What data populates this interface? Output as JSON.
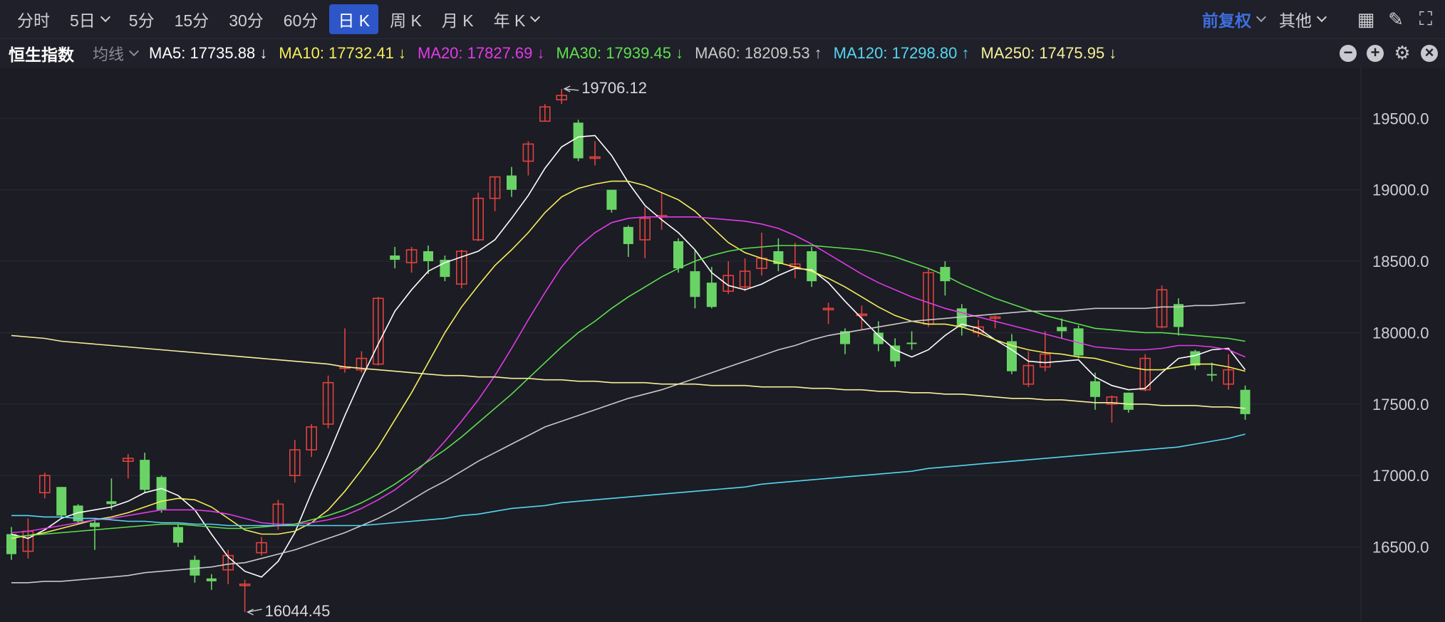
{
  "toolbar": {
    "tabs": [
      {
        "label": "分时",
        "dropdown": false,
        "active": false
      },
      {
        "label": "5日",
        "dropdown": true,
        "active": false
      },
      {
        "label": "5分",
        "dropdown": false,
        "active": false
      },
      {
        "label": "15分",
        "dropdown": false,
        "active": false
      },
      {
        "label": "30分",
        "dropdown": false,
        "active": false
      },
      {
        "label": "60分",
        "dropdown": false,
        "active": false
      },
      {
        "label": "日 K",
        "dropdown": false,
        "active": true
      },
      {
        "label": "周 K",
        "dropdown": false,
        "active": false
      },
      {
        "label": "月 K",
        "dropdown": false,
        "active": false
      },
      {
        "label": "年 K",
        "dropdown": true,
        "active": false
      }
    ],
    "adjust_label": "前复权",
    "other_label": "其他",
    "icons": [
      "grid-icon",
      "brush-icon",
      "fullscreen-icon"
    ]
  },
  "ma_bar": {
    "index_name": "恒生指数",
    "ma_selector": "均线",
    "items": [
      {
        "text": "MA5: 17735.88 ↓",
        "color": "#ffffff"
      },
      {
        "text": "MA10: 17732.41 ↓",
        "color": "#f5ef5a"
      },
      {
        "text": "MA20: 17827.69 ↓",
        "color": "#e23ae8"
      },
      {
        "text": "MA30: 17939.45 ↓",
        "color": "#5ee04e"
      },
      {
        "text": "MA60: 18209.53 ↑",
        "color": "#c9c9c9"
      },
      {
        "text": "MA120: 17298.80 ↑",
        "color": "#56d6f2"
      },
      {
        "text": "MA250: 17475.95 ↓",
        "color": "#f7f09a"
      }
    ]
  },
  "colors": {
    "up": "#e0423d",
    "down": "#6ad366",
    "grid": "#2a2b34",
    "axis_text": "#cfcfd4"
  },
  "chart_data": {
    "type": "candlestick",
    "y_ticks": [
      {
        "value": 16500,
        "label": "16500.0"
      },
      {
        "value": 17000,
        "label": "17000.0"
      },
      {
        "value": 17500,
        "label": "17500.0"
      },
      {
        "value": 18000,
        "label": "18000.0"
      },
      {
        "value": 18500,
        "label": "18500.0"
      },
      {
        "value": 19000,
        "label": "19000.0"
      },
      {
        "value": 19500,
        "label": "19500.0"
      }
    ],
    "ylim": [
      15975,
      19855
    ],
    "high_annotation": {
      "label": "19706.12",
      "value": 19706.12,
      "candle": 33
    },
    "low_annotation": {
      "label": "16044.45",
      "value": 16044.45,
      "candle": 14
    },
    "candles": [
      [
        16590,
        16450,
        16640,
        16410
      ],
      [
        16470,
        16610,
        16700,
        16420
      ],
      [
        16880,
        17000,
        17020,
        16840
      ],
      [
        16920,
        16720,
        16920,
        16700
      ],
      [
        16790,
        16680,
        16800,
        16660
      ],
      [
        16670,
        16640,
        16700,
        16480
      ],
      [
        16820,
        16800,
        16980,
        16760
      ],
      [
        17100,
        17120,
        17150,
        16980
      ],
      [
        17110,
        16900,
        17160,
        16880
      ],
      [
        16990,
        16760,
        17000,
        16740
      ],
      [
        16640,
        16530,
        16660,
        16500
      ],
      [
        16410,
        16300,
        16440,
        16250
      ],
      [
        16280,
        16260,
        16310,
        16200
      ],
      [
        16340,
        16440,
        16480,
        16240
      ],
      [
        16240,
        16240,
        16270,
        16044.45
      ],
      [
        16460,
        16530,
        16570,
        16440
      ],
      [
        16650,
        16800,
        16830,
        16620
      ],
      [
        17000,
        17180,
        17250,
        16950
      ],
      [
        17180,
        17340,
        17360,
        17130
      ],
      [
        17360,
        17650,
        17700,
        17330
      ],
      [
        17750,
        17760,
        18030,
        17720
      ],
      [
        17740,
        17820,
        17870,
        17720
      ],
      [
        17780,
        18240,
        18250,
        17770
      ],
      [
        18540,
        18510,
        18600,
        18450
      ],
      [
        18490,
        18580,
        18600,
        18420
      ],
      [
        18570,
        18500,
        18610,
        18410
      ],
      [
        18510,
        18390,
        18540,
        18360
      ],
      [
        18340,
        18570,
        18580,
        18310
      ],
      [
        18650,
        18940,
        18980,
        18640
      ],
      [
        18940,
        19090,
        19090,
        18850
      ],
      [
        19100,
        19000,
        19160,
        18950
      ],
      [
        19200,
        19320,
        19340,
        19100
      ],
      [
        19480,
        19580,
        19600,
        19480
      ],
      [
        19630,
        19660,
        19706.12,
        19600
      ],
      [
        19470,
        19220,
        19490,
        19200
      ],
      [
        19220,
        19230,
        19340,
        19170
      ],
      [
        19000,
        18860,
        19000,
        18840
      ],
      [
        18740,
        18620,
        18750,
        18530
      ],
      [
        18650,
        18800,
        18880,
        18520
      ],
      [
        18820,
        18820,
        18980,
        18720
      ],
      [
        18640,
        18450,
        18660,
        18420
      ],
      [
        18430,
        18250,
        18580,
        18170
      ],
      [
        18350,
        18180,
        18460,
        18170
      ],
      [
        18290,
        18400,
        18500,
        18270
      ],
      [
        18320,
        18430,
        18520,
        18290
      ],
      [
        18450,
        18520,
        18700,
        18400
      ],
      [
        18570,
        18480,
        18660,
        18430
      ],
      [
        18460,
        18480,
        18630,
        18380
      ],
      [
        18570,
        18360,
        18600,
        18320
      ],
      [
        18170,
        18170,
        18210,
        18060
      ],
      [
        18010,
        17920,
        18030,
        17850
      ],
      [
        18120,
        18130,
        18190,
        18020
      ],
      [
        18000,
        17920,
        18080,
        17870
      ],
      [
        17910,
        17800,
        17960,
        17760
      ],
      [
        17930,
        17920,
        18010,
        17880
      ],
      [
        18060,
        18420,
        18450,
        18040
      ],
      [
        18460,
        18360,
        18500,
        18260
      ],
      [
        18170,
        18040,
        18200,
        17980
      ],
      [
        18000,
        18040,
        18090,
        17970
      ],
      [
        18100,
        18110,
        18120,
        18030
      ],
      [
        17940,
        17730,
        17990,
        17710
      ],
      [
        17640,
        17770,
        17870,
        17620
      ],
      [
        17760,
        17850,
        18010,
        17730
      ],
      [
        18040,
        18010,
        18100,
        17960
      ],
      [
        18030,
        17840,
        18050,
        17820
      ],
      [
        17660,
        17550,
        17720,
        17460
      ],
      [
        17500,
        17550,
        17560,
        17370
      ],
      [
        17580,
        17460,
        17580,
        17440
      ],
      [
        17600,
        17820,
        17850,
        17590
      ],
      [
        18040,
        18300,
        18330,
        18030
      ],
      [
        18200,
        18040,
        18240,
        17980
      ],
      [
        17870,
        17770,
        17880,
        17740
      ],
      [
        17710,
        17700,
        17790,
        17660
      ],
      [
        17640,
        17740,
        17850,
        17600
      ],
      [
        17600,
        17430,
        17630,
        17390
      ]
    ],
    "series": [
      {
        "name": "MA5",
        "color": "#ffffff",
        "values": [
          16590,
          16560,
          16620,
          16700,
          16740,
          16760,
          16780,
          16820,
          16880,
          16910,
          16860,
          16760,
          16590,
          16430,
          16330,
          16290,
          16400,
          16600,
          16880,
          17140,
          17420,
          17680,
          17920,
          18150,
          18300,
          18430,
          18490,
          18530,
          18570,
          18650,
          18800,
          18960,
          19150,
          19300,
          19370,
          19380,
          19240,
          19050,
          18890,
          18790,
          18700,
          18580,
          18420,
          18330,
          18300,
          18340,
          18400,
          18450,
          18440,
          18350,
          18220,
          18100,
          17980,
          17880,
          17830,
          17880,
          17980,
          18060,
          18030,
          17950,
          17880,
          17800,
          17790,
          17800,
          17810,
          17690,
          17630,
          17600,
          17610,
          17720,
          17820,
          17840,
          17880,
          17890,
          17740
        ]
      },
      {
        "name": "MA10",
        "color": "#f5ef5a",
        "values": [
          16560,
          16580,
          16600,
          16630,
          16660,
          16690,
          16710,
          16740,
          16780,
          16820,
          16840,
          16830,
          16780,
          16700,
          16620,
          16590,
          16590,
          16610,
          16670,
          16760,
          16890,
          17040,
          17200,
          17390,
          17580,
          17790,
          18000,
          18180,
          18330,
          18470,
          18580,
          18700,
          18840,
          18950,
          19010,
          19040,
          19060,
          19060,
          19030,
          18980,
          18930,
          18850,
          18740,
          18630,
          18560,
          18520,
          18490,
          18460,
          18430,
          18380,
          18320,
          18250,
          18180,
          18120,
          18080,
          18060,
          18060,
          18040,
          18000,
          17950,
          17910,
          17880,
          17860,
          17850,
          17830,
          17820,
          17790,
          17760,
          17740,
          17740,
          17760,
          17780,
          17780,
          17760,
          17730
        ]
      },
      {
        "name": "MA20",
        "color": "#e23ae8",
        "values": [
          16600,
          16610,
          16630,
          16650,
          16670,
          16690,
          16700,
          16720,
          16740,
          16760,
          16760,
          16760,
          16750,
          16730,
          16700,
          16670,
          16660,
          16660,
          16670,
          16690,
          16720,
          16770,
          16830,
          16900,
          16990,
          17110,
          17240,
          17380,
          17530,
          17700,
          17890,
          18090,
          18280,
          18460,
          18600,
          18700,
          18770,
          18800,
          18810,
          18810,
          18810,
          18810,
          18800,
          18790,
          18780,
          18760,
          18730,
          18680,
          18620,
          18550,
          18480,
          18410,
          18350,
          18300,
          18250,
          18210,
          18170,
          18140,
          18110,
          18080,
          18050,
          18020,
          17990,
          17960,
          17930,
          17900,
          17890,
          17880,
          17880,
          17890,
          17910,
          17910,
          17900,
          17880,
          17830
        ]
      },
      {
        "name": "MA30",
        "color": "#5ee04e",
        "values": [
          16570,
          16580,
          16590,
          16600,
          16610,
          16620,
          16630,
          16640,
          16650,
          16660,
          16660,
          16650,
          16640,
          16630,
          16630,
          16640,
          16650,
          16660,
          16690,
          16720,
          16760,
          16810,
          16870,
          16940,
          17020,
          17100,
          17180,
          17270,
          17370,
          17470,
          17570,
          17680,
          17790,
          17900,
          18000,
          18080,
          18170,
          18250,
          18320,
          18390,
          18450,
          18500,
          18540,
          18570,
          18590,
          18600,
          18610,
          18610,
          18610,
          18600,
          18590,
          18580,
          18560,
          18530,
          18490,
          18450,
          18400,
          18340,
          18290,
          18240,
          18200,
          18160,
          18120,
          18090,
          18060,
          18030,
          18020,
          18010,
          18000,
          18000,
          17990,
          17980,
          17970,
          17960,
          17940
        ]
      },
      {
        "name": "MA60",
        "color": "#c9c9c9",
        "values": [
          16250,
          16250,
          16260,
          16260,
          16270,
          16280,
          16290,
          16300,
          16320,
          16330,
          16340,
          16350,
          16360,
          16380,
          16390,
          16420,
          16450,
          16480,
          16520,
          16560,
          16600,
          16650,
          16700,
          16760,
          16830,
          16900,
          16960,
          17030,
          17100,
          17160,
          17220,
          17280,
          17340,
          17380,
          17420,
          17460,
          17500,
          17540,
          17570,
          17600,
          17640,
          17680,
          17720,
          17760,
          17800,
          17840,
          17880,
          17910,
          17950,
          17980,
          18000,
          18020,
          18040,
          18060,
          18080,
          18090,
          18100,
          18110,
          18120,
          18130,
          18140,
          18150,
          18150,
          18150,
          18160,
          18170,
          18170,
          18170,
          18170,
          18180,
          18180,
          18190,
          18190,
          18200,
          18210
        ]
      },
      {
        "name": "MA120",
        "color": "#56d6f2",
        "values": [
          16720,
          16720,
          16710,
          16710,
          16700,
          16700,
          16690,
          16680,
          16680,
          16670,
          16670,
          16660,
          16660,
          16650,
          16650,
          16650,
          16650,
          16650,
          16650,
          16650,
          16650,
          16650,
          16660,
          16670,
          16680,
          16690,
          16700,
          16720,
          16730,
          16750,
          16770,
          16780,
          16790,
          16810,
          16820,
          16830,
          16840,
          16850,
          16860,
          16870,
          16880,
          16890,
          16900,
          16910,
          16920,
          16940,
          16950,
          16960,
          16970,
          16980,
          16990,
          17000,
          17010,
          17020,
          17030,
          17050,
          17060,
          17070,
          17080,
          17090,
          17100,
          17110,
          17120,
          17130,
          17140,
          17150,
          17160,
          17170,
          17180,
          17190,
          17200,
          17220,
          17240,
          17260,
          17290
        ]
      },
      {
        "name": "MA250",
        "color": "#f7f09a",
        "values": [
          17980,
          17970,
          17960,
          17940,
          17930,
          17920,
          17910,
          17900,
          17890,
          17880,
          17870,
          17860,
          17850,
          17840,
          17830,
          17820,
          17810,
          17800,
          17790,
          17780,
          17760,
          17750,
          17740,
          17730,
          17720,
          17710,
          17700,
          17700,
          17690,
          17690,
          17680,
          17680,
          17670,
          17670,
          17660,
          17660,
          17650,
          17650,
          17650,
          17640,
          17640,
          17640,
          17630,
          17630,
          17630,
          17620,
          17620,
          17620,
          17610,
          17610,
          17600,
          17600,
          17590,
          17590,
          17580,
          17580,
          17570,
          17570,
          17560,
          17550,
          17540,
          17540,
          17530,
          17530,
          17520,
          17510,
          17510,
          17500,
          17500,
          17490,
          17490,
          17490,
          17480,
          17480,
          17470
        ]
      }
    ]
  }
}
